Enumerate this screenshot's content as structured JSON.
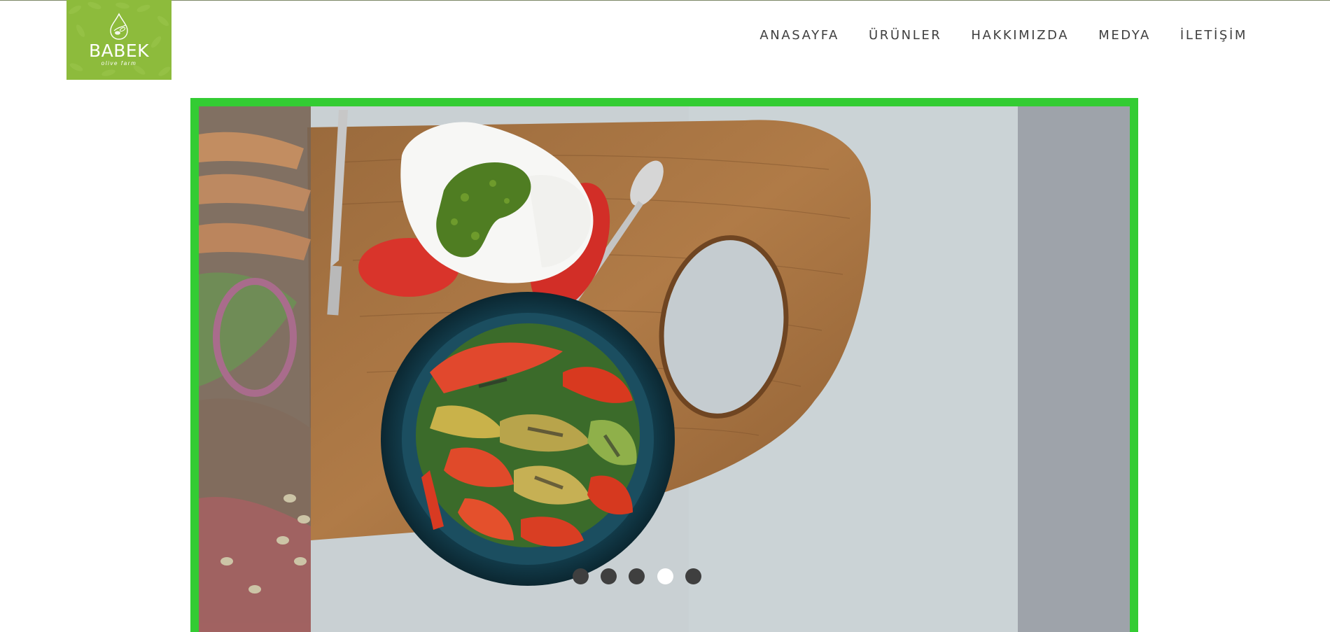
{
  "brand": {
    "name": "BABEK",
    "tagline": "olive farm",
    "color": "#8dbb3c"
  },
  "nav": {
    "items": [
      {
        "label": "ANASAYFA"
      },
      {
        "label": "ÜRÜNLER"
      },
      {
        "label": "HAKKIMIZDA"
      },
      {
        "label": "MEDYA"
      },
      {
        "label": "İLETİŞİM"
      }
    ]
  },
  "slider": {
    "border_color": "#33cc33",
    "slide_count": 5,
    "active_slide": 4,
    "slide_image": "grilled-vegetables-caprese-on-wooden-board"
  }
}
